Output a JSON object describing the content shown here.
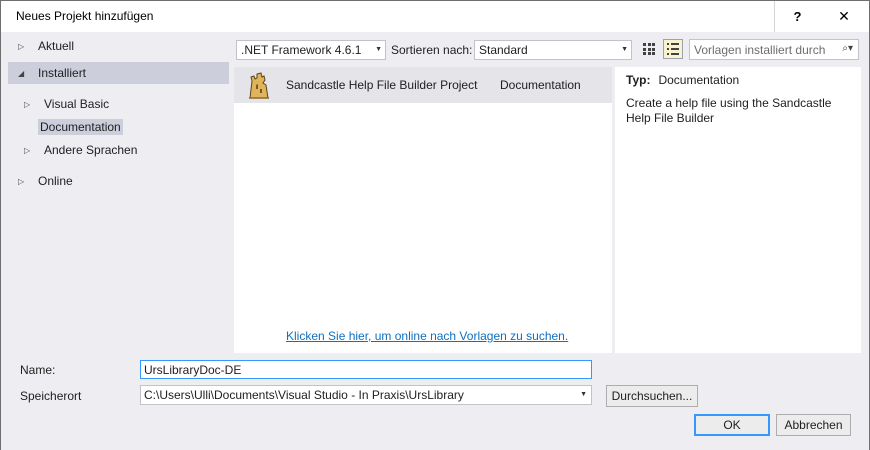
{
  "window": {
    "title": "Neues Projekt hinzufügen",
    "help_label": "?",
    "close_label": "✕"
  },
  "tree": {
    "aktuell": "Aktuell",
    "installiert": "Installiert",
    "visual_basic": "Visual Basic",
    "documentation": "Documentation",
    "andere_sprachen": "Andere Sprachen",
    "online": "Online"
  },
  "toolbar": {
    "framework": ".NET Framework 4.6.1",
    "sort_label": "Sortieren nach:",
    "sort_value": "Standard",
    "search_placeholder": "Vorlagen installiert durch"
  },
  "templates": {
    "items": [
      {
        "name": "Sandcastle Help File Builder Project",
        "language": "Documentation"
      }
    ],
    "online_link": "Klicken Sie hier, um online nach Vorlagen zu suchen."
  },
  "details": {
    "type_label": "Typ:",
    "type_value": "Documentation",
    "description": "Create a help file using the Sandcastle Help File Builder"
  },
  "form": {
    "name_label": "Name:",
    "name_value": "UrsLibraryDoc-DE",
    "location_label": "Speicherort",
    "location_value": "C:\\Users\\Ulli\\Documents\\Visual Studio - In Praxis\\UrsLibrary",
    "browse_button": "Durchsuchen...",
    "ok_button": "OK",
    "cancel_button": "Abbrechen"
  }
}
